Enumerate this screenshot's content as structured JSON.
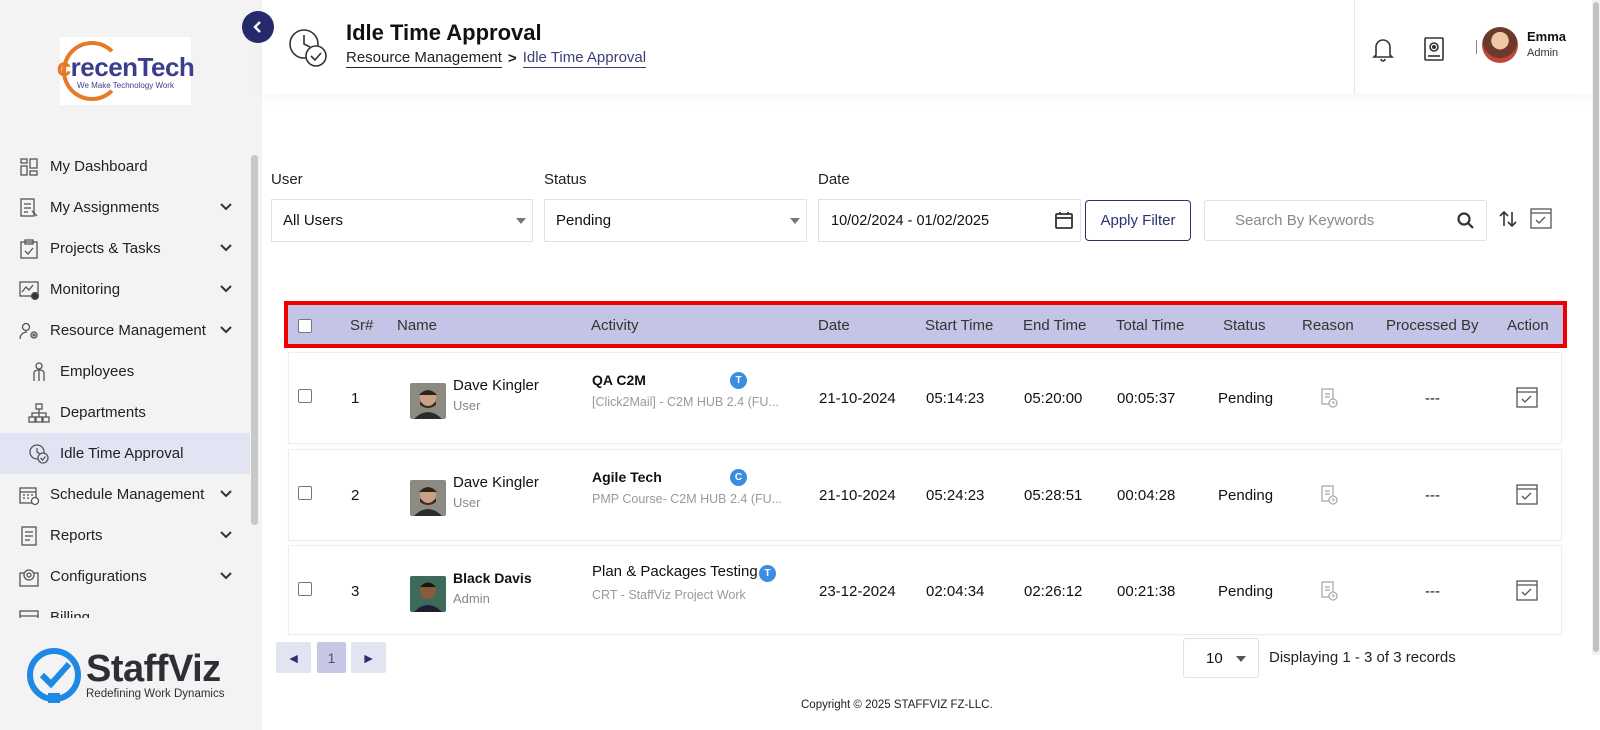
{
  "sidebar": {
    "logo": {
      "text_c": "c",
      "text_rest": "recenTech",
      "tagline": "We Make Technology Work"
    },
    "items": [
      {
        "label": "My Dashboard",
        "icon": "dashboard-icon",
        "chevron": false
      },
      {
        "label": "My Assignments",
        "icon": "assignments-icon",
        "chevron": true
      },
      {
        "label": "Projects & Tasks",
        "icon": "clipboard-icon",
        "chevron": true
      },
      {
        "label": "Monitoring",
        "icon": "monitoring-icon",
        "chevron": true
      },
      {
        "label": "Resource Management",
        "icon": "users-gear-icon",
        "chevron": true
      },
      {
        "label": "Employees",
        "icon": "employee-icon",
        "chevron": false,
        "sub": true
      },
      {
        "label": "Departments",
        "icon": "org-chart-icon",
        "chevron": false,
        "sub": true
      },
      {
        "label": "Idle Time Approval",
        "icon": "clock-check-icon",
        "chevron": false,
        "sub": true,
        "active": true
      },
      {
        "label": "Schedule Management",
        "icon": "calendar-icon",
        "chevron": true
      },
      {
        "label": "Reports",
        "icon": "report-icon",
        "chevron": true
      },
      {
        "label": "Configurations",
        "icon": "config-icon",
        "chevron": true
      },
      {
        "label": "Billing",
        "icon": "billing-icon",
        "chevron": false
      }
    ],
    "brand": {
      "name": "StaffViz",
      "tagline": "Redefining Work Dynamics"
    }
  },
  "header": {
    "title": "Idle Time Approval",
    "breadcrumb": {
      "parent": "Resource Management",
      "separator": ">",
      "current": "Idle Time Approval"
    },
    "user": {
      "name": "Emma",
      "role": "Admin"
    }
  },
  "filters": {
    "user_label": "User",
    "user_value": "All Users",
    "status_label": "Status",
    "status_value": "Pending",
    "date_label": "Date",
    "date_value": "10/02/2024 - 01/02/2025",
    "apply_label": "Apply Filter",
    "search_placeholder": "Search By Keywords"
  },
  "table": {
    "columns": [
      "Sr#",
      "Name",
      "Activity",
      "Date",
      "Start Time",
      "End Time",
      "Total Time",
      "Status",
      "Reason",
      "Processed By",
      "Action"
    ],
    "rows": [
      {
        "sr": "1",
        "name": "Dave Kingler",
        "role": "User",
        "activity": "QA C2M",
        "activity_bold": true,
        "project": "[Click2Mail] - C2M HUB 2.4 (FU...",
        "badge": "T",
        "date": "21-10-2024",
        "start": "05:14:23",
        "end": "05:20:00",
        "total": "00:05:37",
        "status": "Pending",
        "processed_by": "---"
      },
      {
        "sr": "2",
        "name": "Dave Kingler",
        "role": "User",
        "activity": "Agile Tech",
        "activity_bold": true,
        "project": "PMP Course- C2M HUB 2.4 (FU...",
        "badge": "C",
        "date": "21-10-2024",
        "start": "05:24:23",
        "end": "05:28:51",
        "total": "00:04:28",
        "status": "Pending",
        "processed_by": "---"
      },
      {
        "sr": "3",
        "name": "Black Davis",
        "role": "Admin",
        "activity": "Plan & Packages Testing",
        "activity_bold": false,
        "project": "CRT - StaffViz Project Work",
        "badge": "T",
        "date": "23-12-2024",
        "start": "02:04:34",
        "end": "02:26:12",
        "total": "00:21:38",
        "status": "Pending",
        "processed_by": "---"
      }
    ]
  },
  "pagination": {
    "prev": "◄",
    "page": "1",
    "next": "►",
    "per_page": "10",
    "records_text": "Displaying 1 - 3 of 3 records"
  },
  "footer": {
    "copyright": "Copyright © 2025 STAFFVIZ FZ-LLC."
  },
  "colors": {
    "primary": "#252a6b",
    "header_row": "#c4c5e6",
    "highlight": "#ee0000",
    "badge": "#3a8de0",
    "sidebar_bg": "#f3f3f3",
    "active_item": "#e3e4f3"
  }
}
